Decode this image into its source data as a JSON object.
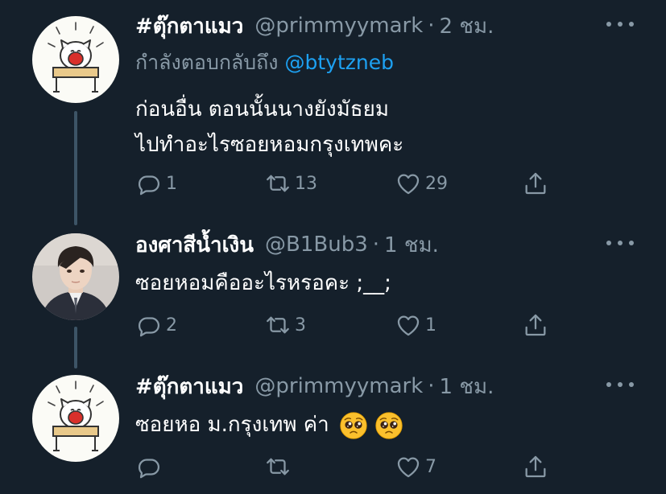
{
  "tweets": [
    {
      "name": "#ตุ๊กตาแมว",
      "handle": "@primmyymark",
      "time": "2 ชม.",
      "reply_label": "กำลังตอบกลับถึง",
      "reply_mention": "@btytzneb",
      "lines": [
        "ก่อนอื่น ตอนนั้นนางยังมัธยม",
        "ไปทำอะไรซอยหอมกรุงเทพคะ"
      ],
      "replies": "1",
      "retweets": "13",
      "likes": "29"
    },
    {
      "name": "องศาสีน้ำเงิน",
      "handle": "@B1Bub3",
      "time": "1 ชม.",
      "lines": [
        "ซอยหอมคืออะไรหรอคะ ;__;"
      ],
      "replies": "2",
      "retweets": "3",
      "likes": "1"
    },
    {
      "name": "#ตุ๊กตาแมว",
      "handle": "@primmyymark",
      "time": "1 ชม.",
      "lines": [
        "ซอยหอ ม.กรุงเทพ ค่า"
      ],
      "replies": "",
      "retweets": "",
      "likes": "7"
    }
  ],
  "dot": "·",
  "colors": {
    "background": "#15202b",
    "secondary": "#8899a6",
    "accent": "#1da1f2"
  },
  "icons": [
    "reply-icon",
    "retweet-icon",
    "like-icon",
    "share-icon",
    "more-icon",
    "pleading-face-emoji"
  ]
}
